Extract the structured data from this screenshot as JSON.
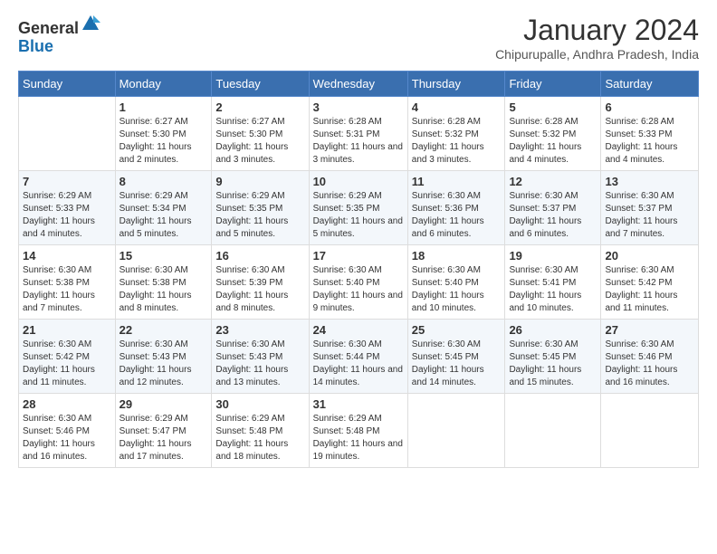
{
  "logo": {
    "general": "General",
    "blue": "Blue"
  },
  "header": {
    "month": "January 2024",
    "location": "Chipurupalle, Andhra Pradesh, India"
  },
  "weekdays": [
    "Sunday",
    "Monday",
    "Tuesday",
    "Wednesday",
    "Thursday",
    "Friday",
    "Saturday"
  ],
  "weeks": [
    [
      {
        "day": "",
        "sunrise": "",
        "sunset": "",
        "daylight": ""
      },
      {
        "day": "1",
        "sunrise": "Sunrise: 6:27 AM",
        "sunset": "Sunset: 5:30 PM",
        "daylight": "Daylight: 11 hours and 2 minutes."
      },
      {
        "day": "2",
        "sunrise": "Sunrise: 6:27 AM",
        "sunset": "Sunset: 5:30 PM",
        "daylight": "Daylight: 11 hours and 3 minutes."
      },
      {
        "day": "3",
        "sunrise": "Sunrise: 6:28 AM",
        "sunset": "Sunset: 5:31 PM",
        "daylight": "Daylight: 11 hours and 3 minutes."
      },
      {
        "day": "4",
        "sunrise": "Sunrise: 6:28 AM",
        "sunset": "Sunset: 5:32 PM",
        "daylight": "Daylight: 11 hours and 3 minutes."
      },
      {
        "day": "5",
        "sunrise": "Sunrise: 6:28 AM",
        "sunset": "Sunset: 5:32 PM",
        "daylight": "Daylight: 11 hours and 4 minutes."
      },
      {
        "day": "6",
        "sunrise": "Sunrise: 6:28 AM",
        "sunset": "Sunset: 5:33 PM",
        "daylight": "Daylight: 11 hours and 4 minutes."
      }
    ],
    [
      {
        "day": "7",
        "sunrise": "Sunrise: 6:29 AM",
        "sunset": "Sunset: 5:33 PM",
        "daylight": "Daylight: 11 hours and 4 minutes."
      },
      {
        "day": "8",
        "sunrise": "Sunrise: 6:29 AM",
        "sunset": "Sunset: 5:34 PM",
        "daylight": "Daylight: 11 hours and 5 minutes."
      },
      {
        "day": "9",
        "sunrise": "Sunrise: 6:29 AM",
        "sunset": "Sunset: 5:35 PM",
        "daylight": "Daylight: 11 hours and 5 minutes."
      },
      {
        "day": "10",
        "sunrise": "Sunrise: 6:29 AM",
        "sunset": "Sunset: 5:35 PM",
        "daylight": "Daylight: 11 hours and 5 minutes."
      },
      {
        "day": "11",
        "sunrise": "Sunrise: 6:30 AM",
        "sunset": "Sunset: 5:36 PM",
        "daylight": "Daylight: 11 hours and 6 minutes."
      },
      {
        "day": "12",
        "sunrise": "Sunrise: 6:30 AM",
        "sunset": "Sunset: 5:37 PM",
        "daylight": "Daylight: 11 hours and 6 minutes."
      },
      {
        "day": "13",
        "sunrise": "Sunrise: 6:30 AM",
        "sunset": "Sunset: 5:37 PM",
        "daylight": "Daylight: 11 hours and 7 minutes."
      }
    ],
    [
      {
        "day": "14",
        "sunrise": "Sunrise: 6:30 AM",
        "sunset": "Sunset: 5:38 PM",
        "daylight": "Daylight: 11 hours and 7 minutes."
      },
      {
        "day": "15",
        "sunrise": "Sunrise: 6:30 AM",
        "sunset": "Sunset: 5:38 PM",
        "daylight": "Daylight: 11 hours and 8 minutes."
      },
      {
        "day": "16",
        "sunrise": "Sunrise: 6:30 AM",
        "sunset": "Sunset: 5:39 PM",
        "daylight": "Daylight: 11 hours and 8 minutes."
      },
      {
        "day": "17",
        "sunrise": "Sunrise: 6:30 AM",
        "sunset": "Sunset: 5:40 PM",
        "daylight": "Daylight: 11 hours and 9 minutes."
      },
      {
        "day": "18",
        "sunrise": "Sunrise: 6:30 AM",
        "sunset": "Sunset: 5:40 PM",
        "daylight": "Daylight: 11 hours and 10 minutes."
      },
      {
        "day": "19",
        "sunrise": "Sunrise: 6:30 AM",
        "sunset": "Sunset: 5:41 PM",
        "daylight": "Daylight: 11 hours and 10 minutes."
      },
      {
        "day": "20",
        "sunrise": "Sunrise: 6:30 AM",
        "sunset": "Sunset: 5:42 PM",
        "daylight": "Daylight: 11 hours and 11 minutes."
      }
    ],
    [
      {
        "day": "21",
        "sunrise": "Sunrise: 6:30 AM",
        "sunset": "Sunset: 5:42 PM",
        "daylight": "Daylight: 11 hours and 11 minutes."
      },
      {
        "day": "22",
        "sunrise": "Sunrise: 6:30 AM",
        "sunset": "Sunset: 5:43 PM",
        "daylight": "Daylight: 11 hours and 12 minutes."
      },
      {
        "day": "23",
        "sunrise": "Sunrise: 6:30 AM",
        "sunset": "Sunset: 5:43 PM",
        "daylight": "Daylight: 11 hours and 13 minutes."
      },
      {
        "day": "24",
        "sunrise": "Sunrise: 6:30 AM",
        "sunset": "Sunset: 5:44 PM",
        "daylight": "Daylight: 11 hours and 14 minutes."
      },
      {
        "day": "25",
        "sunrise": "Sunrise: 6:30 AM",
        "sunset": "Sunset: 5:45 PM",
        "daylight": "Daylight: 11 hours and 14 minutes."
      },
      {
        "day": "26",
        "sunrise": "Sunrise: 6:30 AM",
        "sunset": "Sunset: 5:45 PM",
        "daylight": "Daylight: 11 hours and 15 minutes."
      },
      {
        "day": "27",
        "sunrise": "Sunrise: 6:30 AM",
        "sunset": "Sunset: 5:46 PM",
        "daylight": "Daylight: 11 hours and 16 minutes."
      }
    ],
    [
      {
        "day": "28",
        "sunrise": "Sunrise: 6:30 AM",
        "sunset": "Sunset: 5:46 PM",
        "daylight": "Daylight: 11 hours and 16 minutes."
      },
      {
        "day": "29",
        "sunrise": "Sunrise: 6:29 AM",
        "sunset": "Sunset: 5:47 PM",
        "daylight": "Daylight: 11 hours and 17 minutes."
      },
      {
        "day": "30",
        "sunrise": "Sunrise: 6:29 AM",
        "sunset": "Sunset: 5:48 PM",
        "daylight": "Daylight: 11 hours and 18 minutes."
      },
      {
        "day": "31",
        "sunrise": "Sunrise: 6:29 AM",
        "sunset": "Sunset: 5:48 PM",
        "daylight": "Daylight: 11 hours and 19 minutes."
      },
      {
        "day": "",
        "sunrise": "",
        "sunset": "",
        "daylight": ""
      },
      {
        "day": "",
        "sunrise": "",
        "sunset": "",
        "daylight": ""
      },
      {
        "day": "",
        "sunrise": "",
        "sunset": "",
        "daylight": ""
      }
    ]
  ]
}
